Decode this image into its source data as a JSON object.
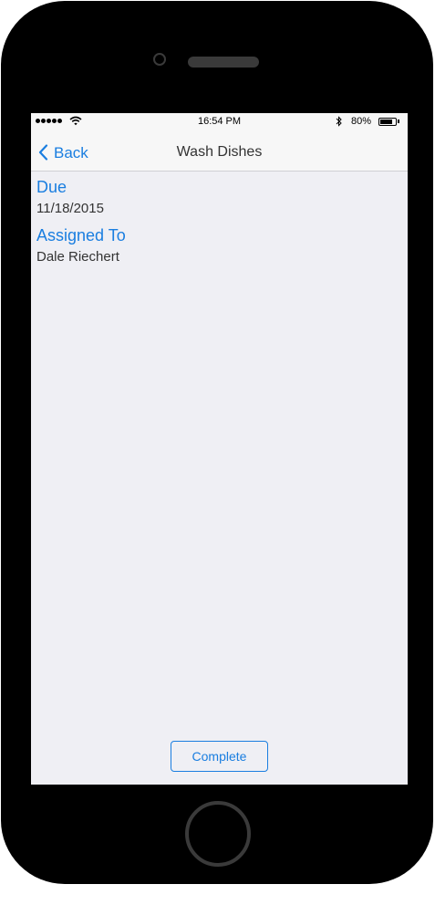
{
  "status_bar": {
    "time": "16:54 PM",
    "battery_percent": "80%",
    "battery_level": 0.8,
    "signal_bars": 5
  },
  "nav": {
    "back_label": "Back",
    "title": "Wash Dishes"
  },
  "details": {
    "due_label": "Due",
    "due_value": "11/18/2015",
    "assigned_label": "Assigned To",
    "assigned_value": "Dale Riechert"
  },
  "actions": {
    "complete_label": "Complete"
  },
  "colors": {
    "accent": "#1a7ee0",
    "background": "#efeff4",
    "bar": "#f7f7f7"
  }
}
